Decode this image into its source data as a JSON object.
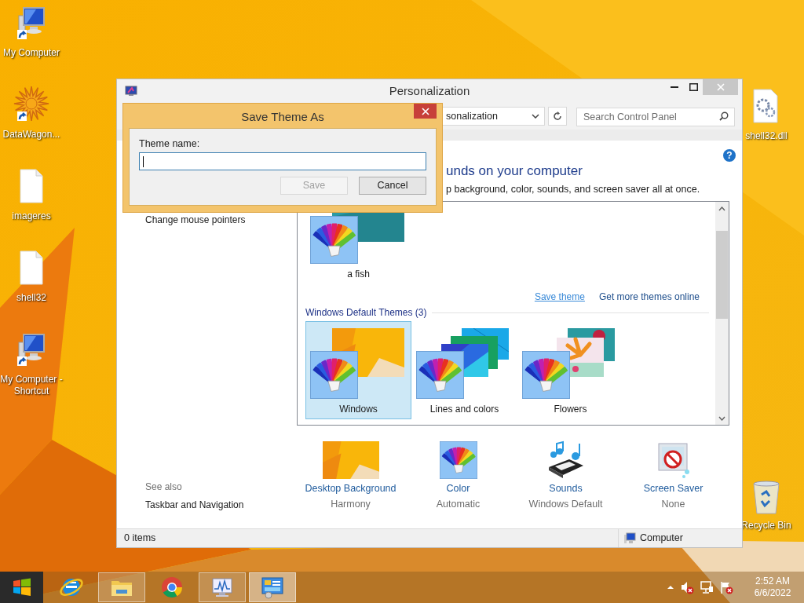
{
  "desktop": {
    "left_icons": [
      {
        "label": "My Computer",
        "kind": "computer",
        "shortcut": true
      },
      {
        "label": "DataWagon...",
        "kind": "star",
        "shortcut": true
      },
      {
        "label": "imageres",
        "kind": "file",
        "shortcut": false
      },
      {
        "label": "shell32",
        "kind": "file",
        "shortcut": false
      },
      {
        "label": "My Computer - Shortcut",
        "kind": "computer",
        "shortcut": true
      }
    ],
    "right_icons": [
      {
        "label": "shell32.dll",
        "kind": "gear_file",
        "shortcut": false
      },
      {
        "label": "Recycle Bin",
        "kind": "recycle_bin",
        "shortcut": false
      }
    ]
  },
  "window": {
    "title": "Personalization",
    "address": "sonalization",
    "search_placeholder": "Search Control Panel",
    "help": "?",
    "tasks": [
      "Change mouse pointers"
    ],
    "see_also": {
      "heading": "See also",
      "links": [
        "Taskbar and Navigation"
      ]
    },
    "heading": "unds on your computer",
    "description": "p background, color, sounds, and screen saver all at once.",
    "my_themes": [
      {
        "label": "a fish",
        "kind": "fish",
        "selected": false
      }
    ],
    "theme_links": [
      {
        "label": "Save theme",
        "hovered": true
      },
      {
        "label": "Get more themes online",
        "hovered": false
      }
    ],
    "default_themes": {
      "title": "Windows Default Themes (3)",
      "themes": [
        {
          "label": "Windows",
          "kind": "windows",
          "selected": true
        },
        {
          "label": "Lines and colors",
          "kind": "lines",
          "selected": false
        },
        {
          "label": "Flowers",
          "kind": "flowers",
          "selected": false
        }
      ]
    },
    "settings": [
      {
        "label": "Desktop Background",
        "value": "Harmony",
        "kind": "background"
      },
      {
        "label": "Color",
        "value": "Automatic",
        "kind": "color"
      },
      {
        "label": "Sounds",
        "value": "Windows Default",
        "kind": "sounds"
      },
      {
        "label": "Screen Saver",
        "value": "None",
        "kind": "screen_saver"
      }
    ],
    "status_bar": {
      "items": "0 items",
      "location": "Computer"
    }
  },
  "dialog": {
    "title": "Save Theme As",
    "field_label": "Theme name:",
    "buttons": [
      {
        "label": "Save",
        "disabled": true
      },
      {
        "label": "Cancel",
        "disabled": false
      }
    ]
  },
  "taskbar": {
    "apps": [
      {
        "kind": "ie",
        "running": false,
        "selected": false
      },
      {
        "kind": "explorer",
        "running": true,
        "selected": false
      },
      {
        "kind": "chrome",
        "running": false,
        "selected": false
      },
      {
        "kind": "resmon",
        "running": true,
        "selected": false
      },
      {
        "kind": "control_panel",
        "running": true,
        "selected": true
      }
    ],
    "tray": [
      {
        "kind": "chevron"
      },
      {
        "kind": "volume_muted"
      },
      {
        "kind": "network"
      },
      {
        "kind": "flag_alert"
      }
    ],
    "time": "2:52 AM",
    "date": "6/6/2022"
  }
}
